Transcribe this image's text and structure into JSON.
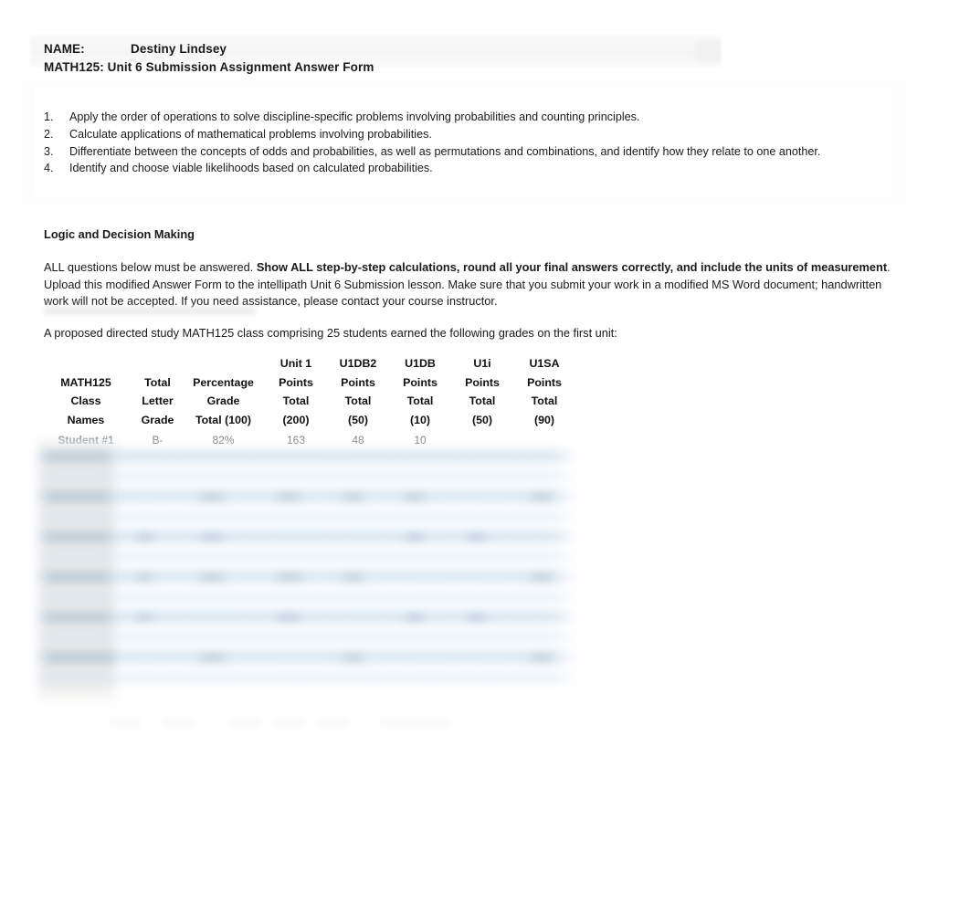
{
  "document": {
    "header": {
      "name_label": "NAME:",
      "name_value": "Destiny Lindsey",
      "form_title": "MATH125: Unit 6 Submission Assignment Answer Form"
    },
    "objectives": [
      {
        "number": "1.",
        "text": "Apply the order of operations to solve discipline-specific problems involving probabilities and counting principles."
      },
      {
        "number": "2.",
        "text": "Calculate applications of mathematical problems involving probabilities."
      },
      {
        "number": "3.",
        "text": "Differentiate between the concepts of odds and probabilities, as well as permutations and combinations, and identify how they relate to one another."
      },
      {
        "number": "4.",
        "text": "Identify and choose viable likelihoods based on calculated probabilities."
      }
    ],
    "section_title": "Logic and Decision Making",
    "instructions": {
      "part1": "ALL questions below must be answered. ",
      "bold": "Show ALL step-by-step calculations, round all your final answers correctly, and include the units of measurement",
      "part2": ". Upload this modified Answer Form to the intellipath Unit 6 Submission lesson. Make sure that you  submit your work in a modified MS Word document; handwritten work will not be accepted. If you need assistance, please contact your course instructor."
    },
    "table_lead": "A proposed directed study MATH125 class comprising 25 students earned the following grades on the first unit:"
  },
  "grades_table": {
    "headers": [
      {
        "line1": "MATH125",
        "line2": "Class",
        "line3": "Names",
        "line4": ""
      },
      {
        "line1": "Total",
        "line2": "Letter",
        "line3": "Grade",
        "line4": ""
      },
      {
        "line1": "Percentage",
        "line2": "Grade",
        "line3": "Total (100)",
        "line4": ""
      },
      {
        "line1": "Unit 1",
        "line2": "Points",
        "line3": "Total",
        "line4": "(200)"
      },
      {
        "line1": "U1DB2",
        "line2": "Points",
        "line3": "Total",
        "line4": "(50)"
      },
      {
        "line1": "U1DB",
        "line2": "Points",
        "line3": "Total",
        "line4": "(10)"
      },
      {
        "line1": "U1i",
        "line2": "Points",
        "line3": "Total",
        "line4": "(50)"
      },
      {
        "line1": "U1SA",
        "line2": "Points",
        "line3": "Total",
        "line4": "(90)"
      }
    ],
    "visible_rows": [
      {
        "name": "Student #1",
        "letter_grade": "B-",
        "percentage": "82%",
        "unit1_points": "163",
        "u1db2_points": "48",
        "u1db_points": "10",
        "u1i_points": "",
        "u1sa_points": ""
      }
    ],
    "redacted_note": "remaining student rows are blurred / not legible"
  },
  "colors": {
    "page_background": "#ffffff",
    "text": "#1a1a1a",
    "table_band_blue": "#bfd7ea",
    "table_band_light": "#d9e8f4",
    "name_cell_text": "#4a5560",
    "header_shade": "#f5f5f5"
  }
}
